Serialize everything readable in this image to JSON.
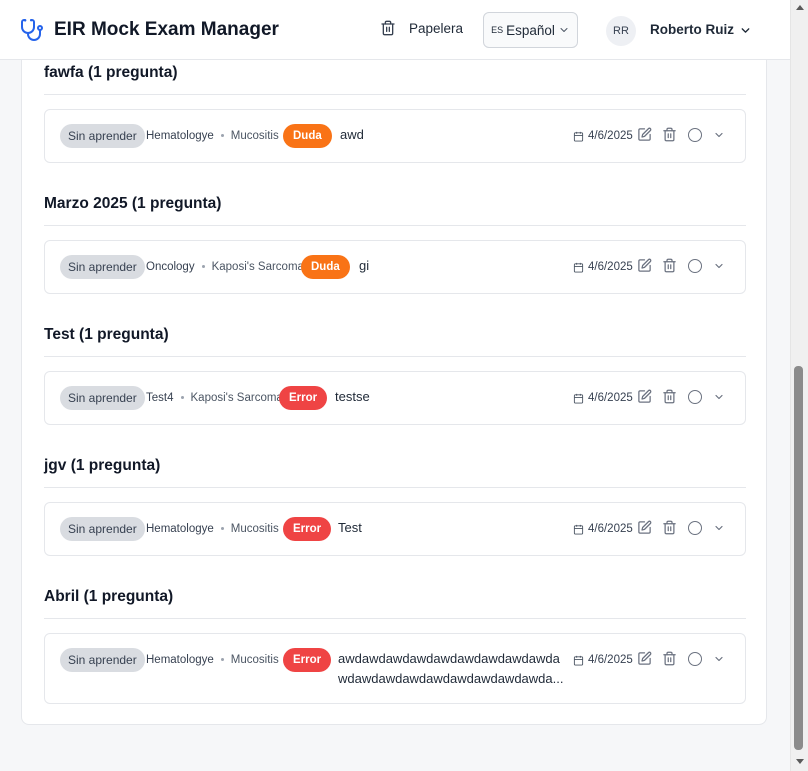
{
  "header": {
    "app_title": "EIR Mock Exam Manager",
    "trash_label": "Papelera",
    "language": {
      "flag": "ES",
      "label": "Español"
    },
    "user": {
      "initials": "RR",
      "name": "Roberto Ruiz"
    }
  },
  "colors": {
    "brand": "#2563eb",
    "doubt": "#f97316",
    "error": "#ef4444",
    "status_chip": "#d9dce1"
  },
  "sections": [
    {
      "title": "fawfa",
      "count": "(1 pregunta)",
      "question": {
        "status": "Sin aprender",
        "subject": "Hematologye",
        "topic": "Mucositis",
        "badge": "Duda",
        "badge_type": "doubt",
        "text": "awd",
        "text_line2": "",
        "date": "4/6/2025"
      }
    },
    {
      "title": "Marzo 2025",
      "count": "(1 pregunta)",
      "question": {
        "status": "Sin aprender",
        "subject": "Oncology",
        "topic": "Kaposi's Sarcoma",
        "badge": "Duda",
        "badge_type": "doubt",
        "text": "gi",
        "text_line2": "",
        "date": "4/6/2025"
      }
    },
    {
      "title": "Test",
      "count": "(1 pregunta)",
      "question": {
        "status": "Sin aprender",
        "subject": "Test4",
        "topic": "Kaposi's Sarcoma",
        "badge": "Error",
        "badge_type": "error",
        "text": "testse",
        "text_line2": "",
        "date": "4/6/2025"
      }
    },
    {
      "title": "jgv",
      "count": "(1 pregunta)",
      "question": {
        "status": "Sin aprender",
        "subject": "Hematologye",
        "topic": "Mucositis",
        "badge": "Error",
        "badge_type": "error",
        "text": "Test",
        "text_line2": "",
        "date": "4/6/2025"
      }
    },
    {
      "title": "Abril",
      "count": "(1 pregunta)",
      "question": {
        "status": "Sin aprender",
        "subject": "Hematologye",
        "topic": "Mucositis",
        "badge": "Error",
        "badge_type": "error",
        "text": "awdawdawdawdawdawdawdawdawda",
        "text_line2": "wdawdawdawdawdawdawdawdawda...",
        "date": "4/6/2025"
      }
    }
  ]
}
